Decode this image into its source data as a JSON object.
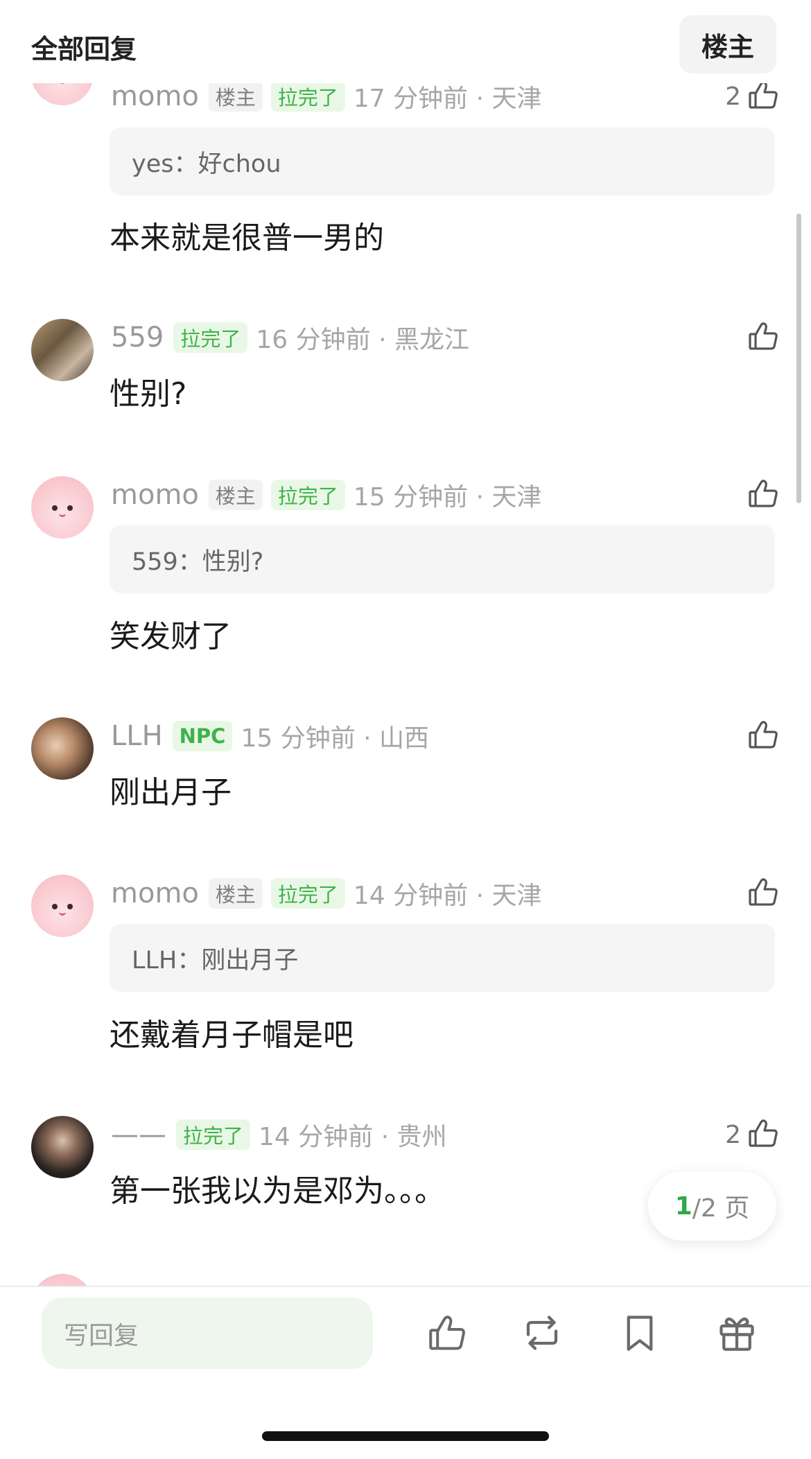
{
  "header": {
    "title": "全部回复",
    "owner_button": "楼主"
  },
  "comments": [
    {
      "user": "momo",
      "owner_tag": "楼主",
      "done_tag": "拉完了",
      "time": "17 分钟前 · 天津",
      "likes": "2",
      "quote": "yes：好chou",
      "text": "本来就是很普一男的"
    },
    {
      "user": "559",
      "done_tag": "拉完了",
      "time": "16 分钟前 · 黑龙江",
      "text": "性别?"
    },
    {
      "user": "momo",
      "owner_tag": "楼主",
      "done_tag": "拉完了",
      "time": "15 分钟前 · 天津",
      "quote": "559：性别?",
      "text": "笑发财了"
    },
    {
      "user": "LLH",
      "npc_tag": "NPC",
      "time": "15 分钟前 · 山西",
      "text": "刚出月子"
    },
    {
      "user": "momo",
      "owner_tag": "楼主",
      "done_tag": "拉完了",
      "time": "14 分钟前 · 天津",
      "quote": "LLH：刚出月子",
      "text": "还戴着月子帽是吧"
    },
    {
      "user": "——",
      "done_tag": "拉完了",
      "time": "14 分钟前 · 贵州",
      "likes": "2",
      "text": "第一张我以为是邓为。。。"
    }
  ],
  "pagination": {
    "current": "1",
    "total": "/2 页"
  },
  "bottom_bar": {
    "reply_placeholder": "写回复",
    "icons": [
      "like-icon",
      "repost-icon",
      "bookmark-icon",
      "gift-icon"
    ]
  },
  "colors": {
    "accent_green": "#3fb24a",
    "tag_green_bg": "#e9f8e6",
    "quote_bg": "#f5f5f5"
  }
}
